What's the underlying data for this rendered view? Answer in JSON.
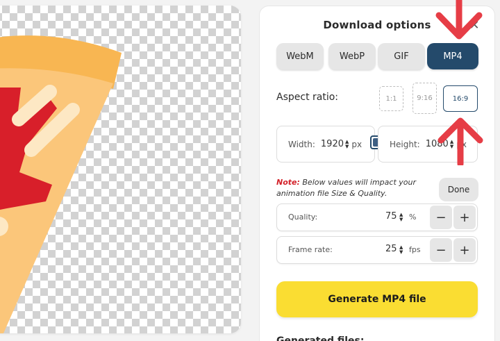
{
  "panel": {
    "title": "Download options",
    "formats": [
      {
        "label": "WebM",
        "active": false
      },
      {
        "label": "WebP",
        "active": false
      },
      {
        "label": "GIF",
        "active": false
      },
      {
        "label": "MP4",
        "active": true
      }
    ],
    "aspect": {
      "label": "Aspect ratio:",
      "options": [
        {
          "label": "1:1",
          "active": false
        },
        {
          "label": "9:16",
          "active": false
        },
        {
          "label": "16:9",
          "active": true
        }
      ]
    },
    "width": {
      "label": "Width:",
      "value": "1920",
      "unit": "px"
    },
    "height": {
      "label": "Height:",
      "value": "1080",
      "unit": "px"
    },
    "note": {
      "prefix": "Note:",
      "text": " Below values will impact your animation file Size & Quality."
    },
    "done_label": "Done",
    "quality": {
      "label": "Quality:",
      "value": "75",
      "unit": "%"
    },
    "frame_rate": {
      "label": "Frame rate:",
      "value": "25",
      "unit": "fps"
    },
    "generate_label": "Generate MP4 file",
    "generated_label": "Generated files:"
  },
  "colors": {
    "accent": "#244a6b",
    "generate": "#fadd32",
    "note_red": "#d3222a",
    "arrow_red": "#e63d46"
  },
  "icons": {
    "close": "close-icon",
    "lock": "aspect-lock-icon",
    "arrows": [
      "pointer-arrow-down-icon",
      "pointer-arrow-up-icon"
    ]
  }
}
